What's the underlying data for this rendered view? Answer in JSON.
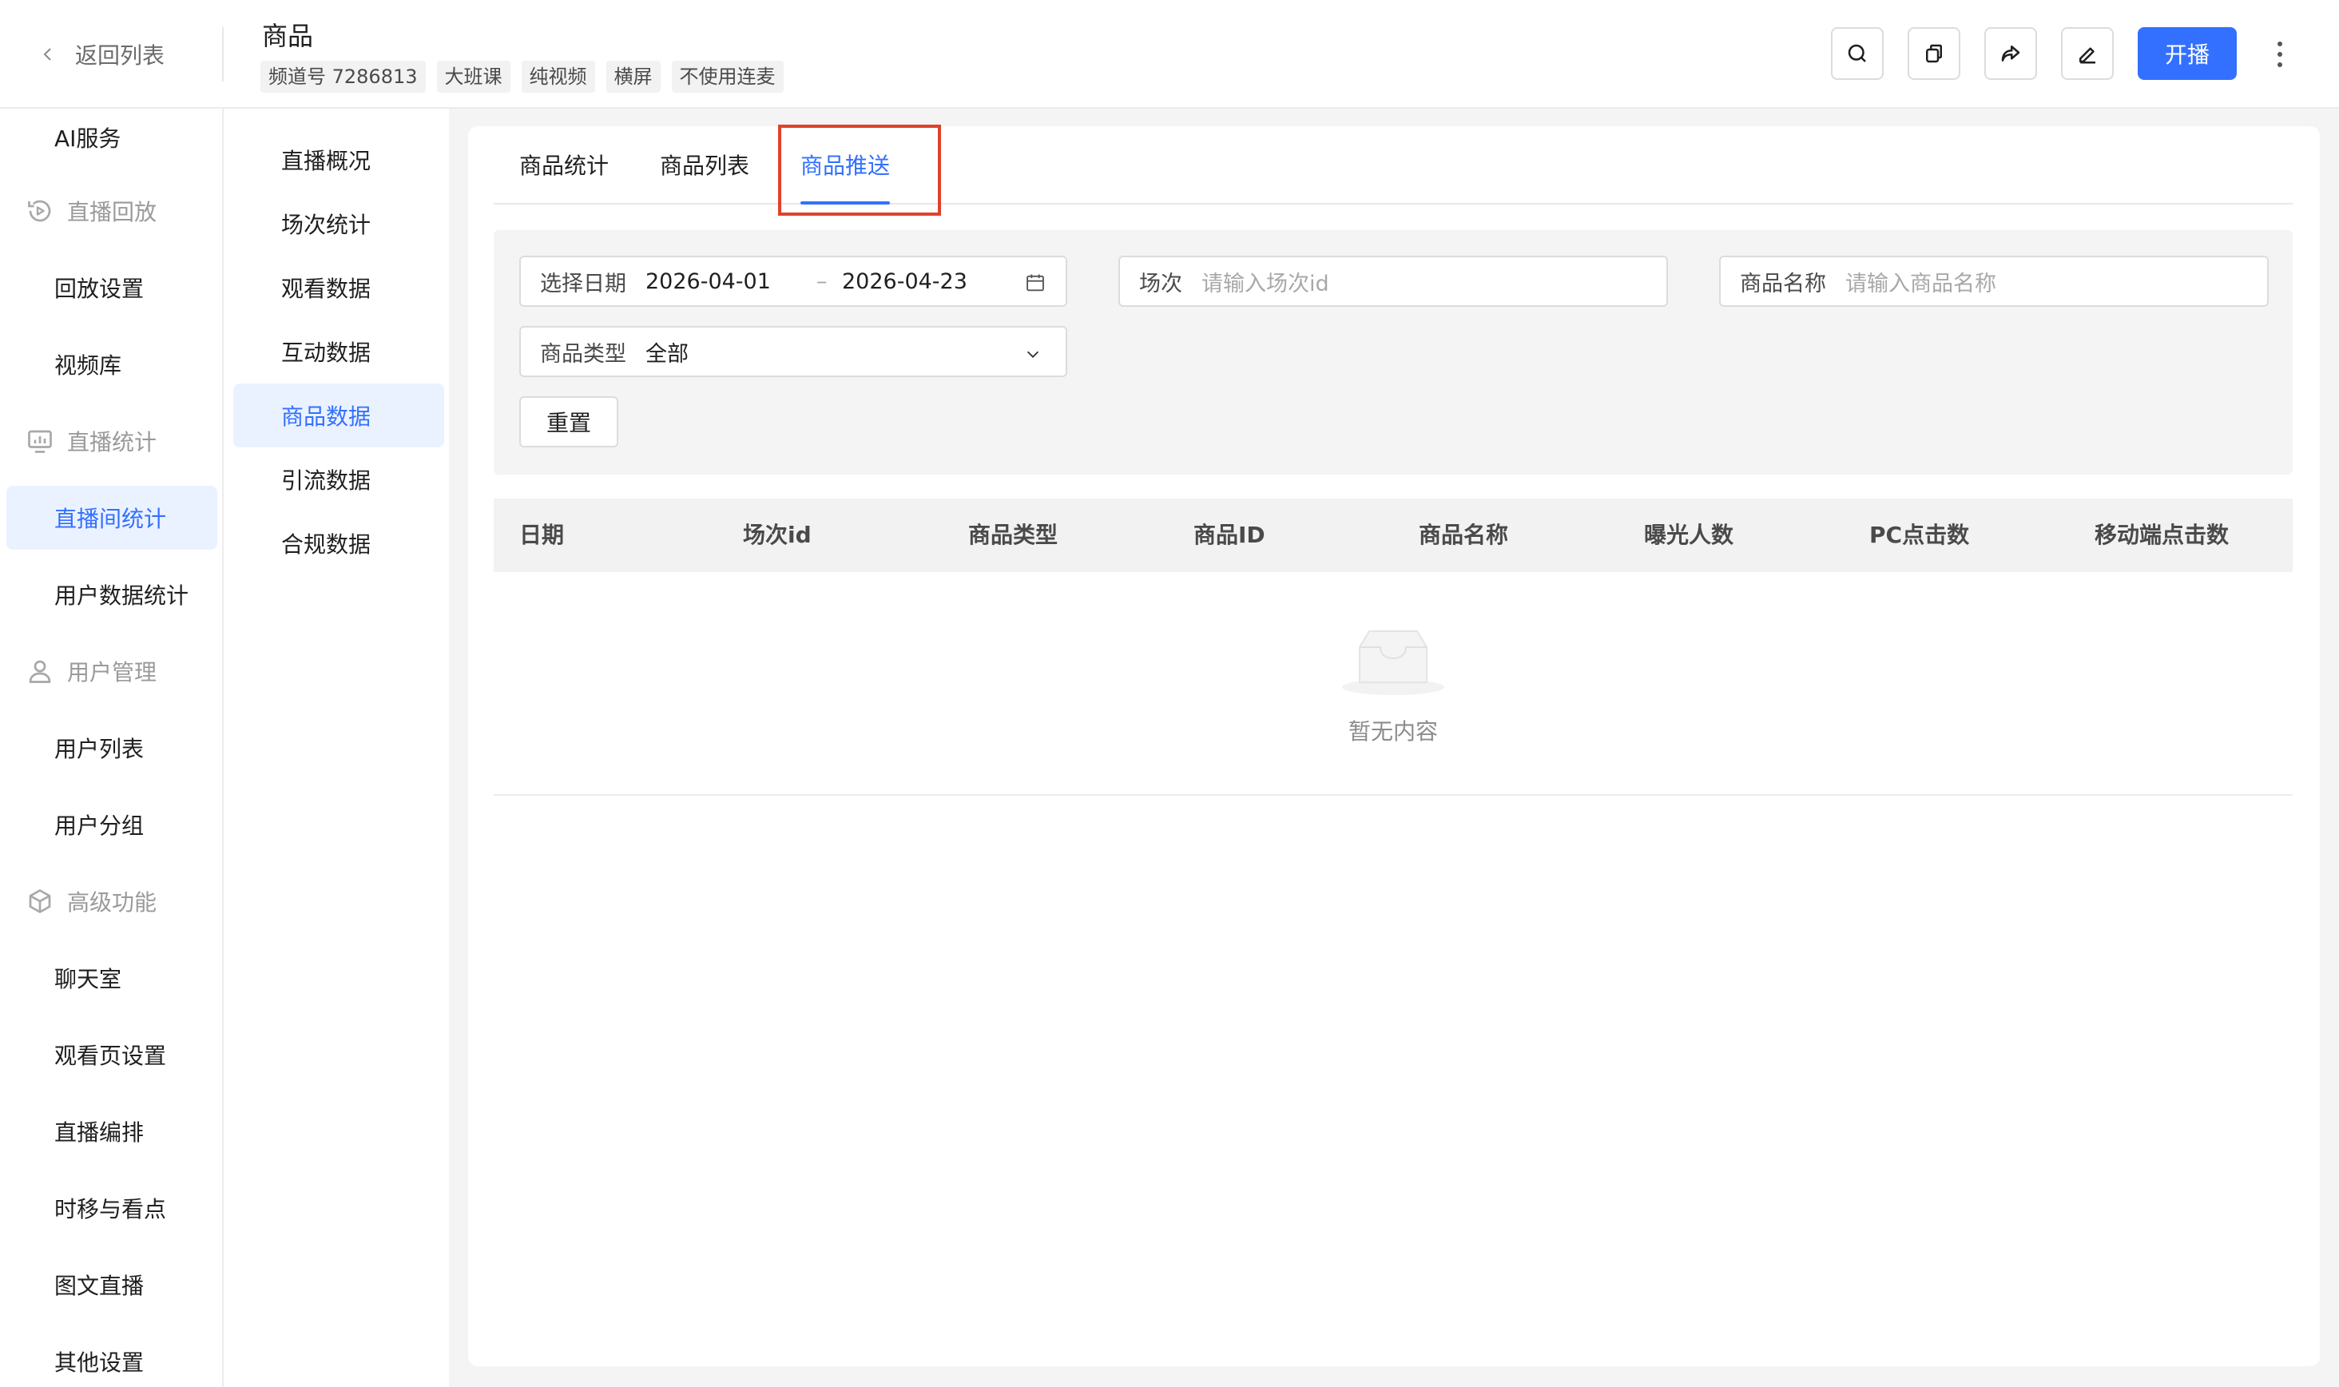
{
  "header": {
    "back_label": "返回列表",
    "title": "商品",
    "tags": [
      "频道号 7286813",
      "大班课",
      "纯视频",
      "横屏",
      "不使用连麦"
    ],
    "start_button": "开播",
    "accent_color": "#3370ff"
  },
  "sidebar": {
    "items": [
      {
        "type": "item",
        "label": "AI服务"
      },
      {
        "type": "group",
        "label": "直播回放",
        "icon": "playback-icon"
      },
      {
        "type": "item",
        "label": "回放设置"
      },
      {
        "type": "item",
        "label": "视频库"
      },
      {
        "type": "group",
        "label": "直播统计",
        "icon": "stats-icon"
      },
      {
        "type": "item",
        "label": "直播间统计",
        "active": true
      },
      {
        "type": "item",
        "label": "用户数据统计"
      },
      {
        "type": "group",
        "label": "用户管理",
        "icon": "user-icon"
      },
      {
        "type": "item",
        "label": "用户列表"
      },
      {
        "type": "item",
        "label": "用户分组"
      },
      {
        "type": "group",
        "label": "高级功能",
        "icon": "cube-icon"
      },
      {
        "type": "item",
        "label": "聊天室"
      },
      {
        "type": "item",
        "label": "观看页设置"
      },
      {
        "type": "item",
        "label": "直播编排"
      },
      {
        "type": "item",
        "label": "时移与看点"
      },
      {
        "type": "item",
        "label": "图文直播"
      },
      {
        "type": "item",
        "label": "其他设置"
      }
    ]
  },
  "subnav": {
    "items": [
      "直播概况",
      "场次统计",
      "观看数据",
      "互动数据",
      "商品数据",
      "引流数据",
      "合规数据"
    ],
    "active": "商品数据"
  },
  "tabs": {
    "items": [
      "商品统计",
      "商品列表",
      "商品推送"
    ],
    "active": "商品推送"
  },
  "filters": {
    "date_label": "选择日期",
    "date_start": "2026-04-01",
    "date_sep": "–",
    "date_end": "2026-04-23",
    "session_label": "场次",
    "session_placeholder": "请输入场次id",
    "product_name_label": "商品名称",
    "product_name_placeholder": "请输入商品名称",
    "product_type_label": "商品类型",
    "product_type_value": "全部",
    "reset_button": "重置"
  },
  "table": {
    "columns": [
      "日期",
      "场次id",
      "商品类型",
      "商品ID",
      "商品名称",
      "曝光人数",
      "PC点击数",
      "移动端点击数"
    ],
    "rows": [],
    "empty_text": "暂无内容"
  }
}
